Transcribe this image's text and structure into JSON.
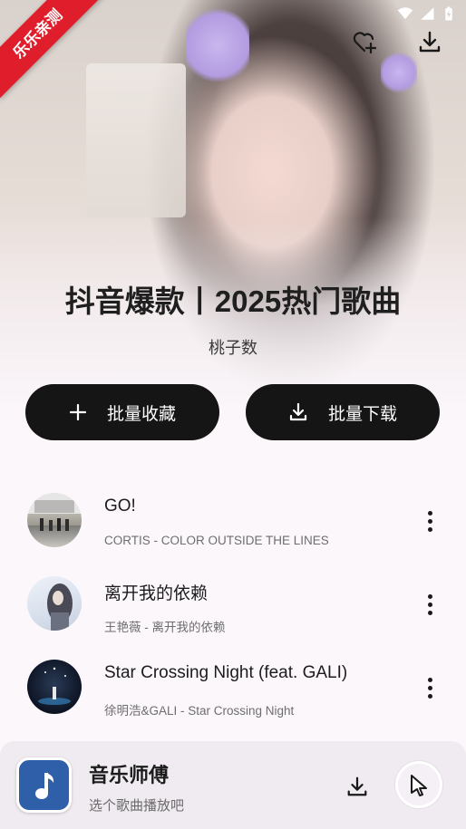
{
  "watermark": "乐乐亲测",
  "playlist": {
    "title": "抖音爆款丨2025热门歌曲",
    "artist": "桃子数"
  },
  "actions": {
    "collect_label": "批量收藏",
    "download_label": "批量下载"
  },
  "top_icons": [
    "heart-add-icon",
    "download-icon"
  ],
  "songs": [
    {
      "name": "GO!",
      "subtitle": "CORTIS - COLOR OUTSIDE THE LINES"
    },
    {
      "name": "离开我的依赖",
      "subtitle": "王艳薇 - 离开我的依赖"
    },
    {
      "name": "Star Crossing Night (feat. GALI)",
      "subtitle": "徐明浩&GALI - Star Crossing Night"
    }
  ],
  "player": {
    "title": "音乐师傅",
    "subtitle": "选个歌曲播放吧"
  },
  "colors": {
    "ribbon": "#e01e2b",
    "pill": "#151515",
    "app_icon": "#2f5fa8"
  }
}
